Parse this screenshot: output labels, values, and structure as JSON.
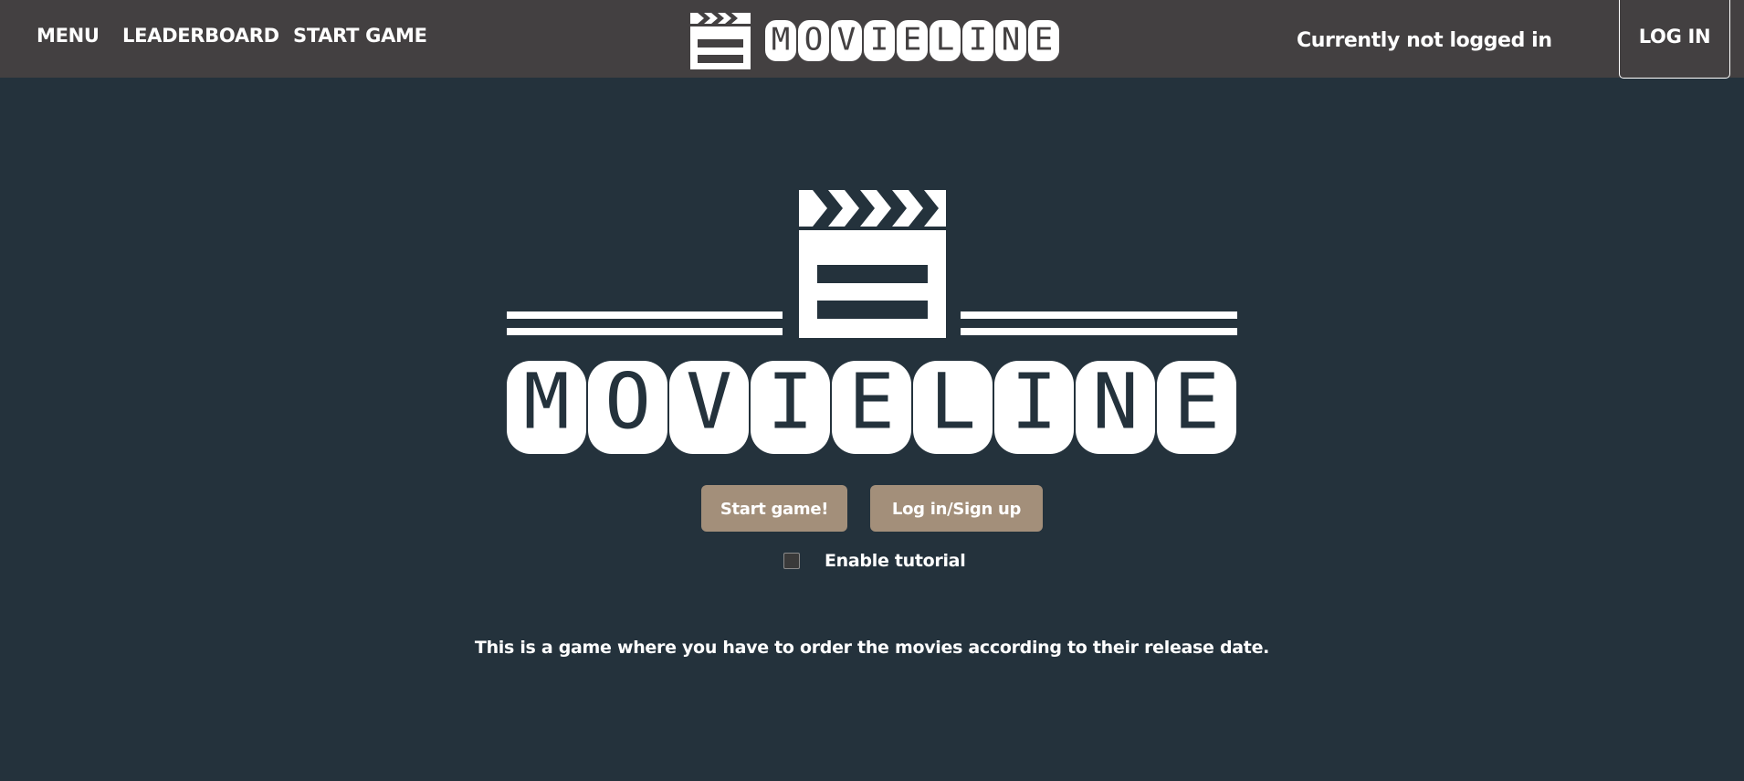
{
  "nav": {
    "menu": "MENU",
    "leaderboard": "LEADERBOARD",
    "start_game": "START GAME"
  },
  "brand": {
    "logo_text": "MOVIELINE",
    "logo_letters": [
      "M",
      "O",
      "V",
      "I",
      "E",
      "L",
      "I",
      "N",
      "E"
    ],
    "icon": "clapperboard-icon"
  },
  "auth": {
    "status": "Currently not logged in",
    "login_label": "LOG IN"
  },
  "hero": {
    "start_button": "Start game!",
    "login_signup_button": "Log in/Sign up",
    "tutorial_label": "Enable tutorial",
    "tutorial_enabled": false,
    "description": "This is a game where you have to order the movies according to their release date."
  },
  "colors": {
    "topbar": "#434041",
    "background": "#24323c",
    "button": "#a38f7a",
    "text": "#ffffff"
  }
}
